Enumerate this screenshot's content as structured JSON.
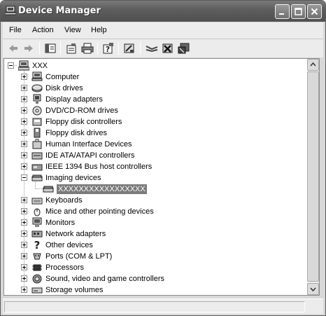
{
  "window": {
    "title": "Device Manager"
  },
  "menu": [
    "File",
    "Action",
    "View",
    "Help"
  ],
  "toolbar": {
    "icons": [
      "back-icon",
      "forward-icon",
      "show-hide-console-tree-icon",
      "properties-icon",
      "print-icon",
      "help-icon",
      "update-driver-icon",
      "scan-hardware-icon",
      "uninstall-icon",
      "disable-icon"
    ]
  },
  "tree": {
    "root": "XXX",
    "items": [
      {
        "label": "Computer",
        "icon": "computer-icon"
      },
      {
        "label": "Disk drives",
        "icon": "disk-drive-icon"
      },
      {
        "label": "Display adapters",
        "icon": "display-adapter-icon"
      },
      {
        "label": "DVD/CD-ROM drives",
        "icon": "dvd-drive-icon"
      },
      {
        "label": "Floppy disk controllers",
        "icon": "floppy-controller-icon"
      },
      {
        "label": "Floppy disk drives",
        "icon": "floppy-drive-icon"
      },
      {
        "label": "Human Interface Devices",
        "icon": "hid-icon"
      },
      {
        "label": "IDE ATA/ATAPI controllers",
        "icon": "ide-controller-icon"
      },
      {
        "label": "IEEE 1394 Bus host controllers",
        "icon": "ieee1394-icon"
      },
      {
        "label": "Imaging devices",
        "icon": "imaging-device-icon",
        "expanded": true
      },
      {
        "label": "XXXXXXXXXXXXXXXXX",
        "icon": "scanner-icon",
        "child": true,
        "selected": true
      },
      {
        "label": "Keyboards",
        "icon": "keyboard-icon"
      },
      {
        "label": "Mice and other pointing devices",
        "icon": "mouse-icon"
      },
      {
        "label": "Monitors",
        "icon": "monitor-icon"
      },
      {
        "label": "Network adapters",
        "icon": "network-adapter-icon"
      },
      {
        "label": "Other devices",
        "icon": "unknown-device-icon"
      },
      {
        "label": "Ports (COM & LPT)",
        "icon": "port-icon"
      },
      {
        "label": "Processors",
        "icon": "processor-icon"
      },
      {
        "label": "Sound, video and game controllers",
        "icon": "sound-icon"
      },
      {
        "label": "Storage volumes",
        "icon": "storage-volume-icon"
      }
    ]
  }
}
